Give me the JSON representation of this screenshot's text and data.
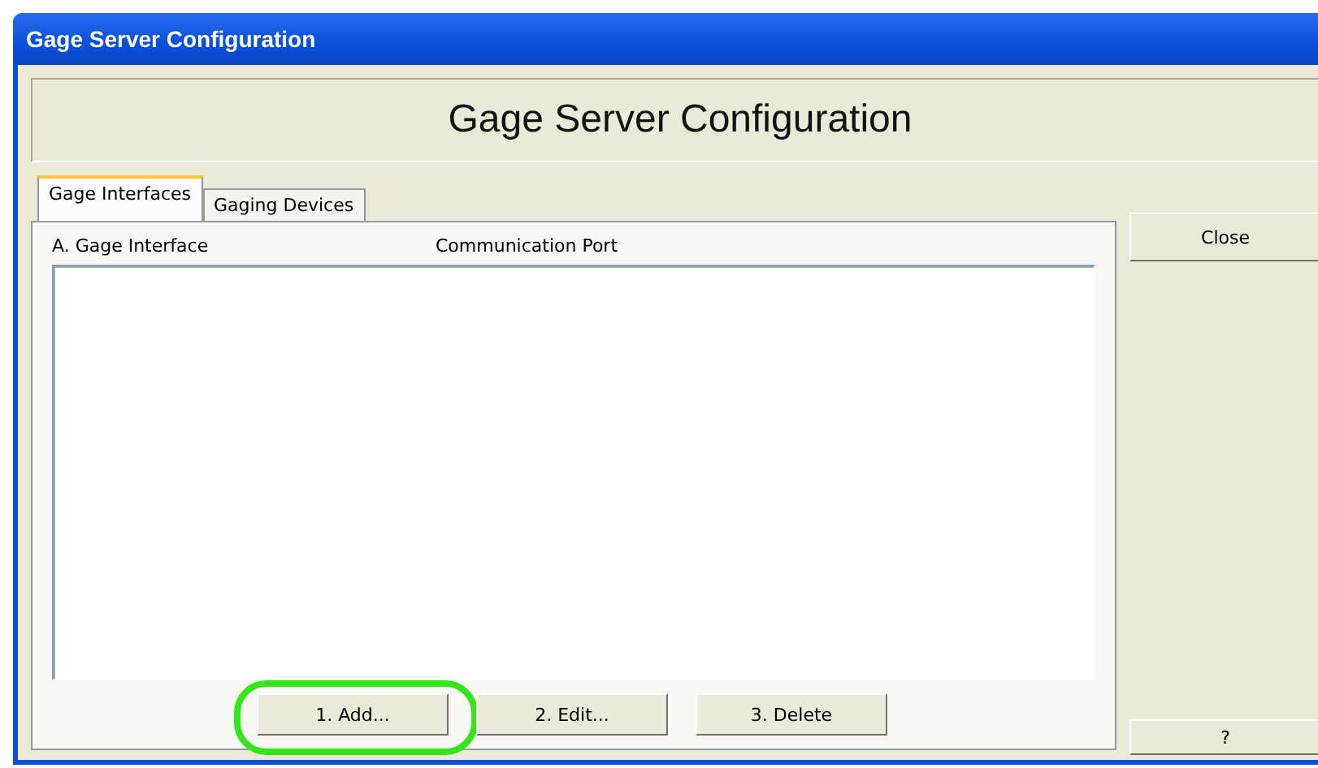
{
  "window": {
    "title": "Gage Server Configuration"
  },
  "header": {
    "title": "Gage Server Configuration"
  },
  "tabs": [
    {
      "label": "Gage Interfaces",
      "selected": true
    },
    {
      "label": "Gaging Devices",
      "selected": false
    }
  ],
  "list": {
    "columns": [
      "A. Gage Interface",
      "Communication Port"
    ]
  },
  "buttons": [
    {
      "label": "1. Add...",
      "highlighted": true
    },
    {
      "label": "2. Edit...",
      "highlighted": false
    },
    {
      "label": "3. Delete",
      "highlighted": false
    }
  ],
  "side_buttons": [
    "Close",
    "?"
  ]
}
